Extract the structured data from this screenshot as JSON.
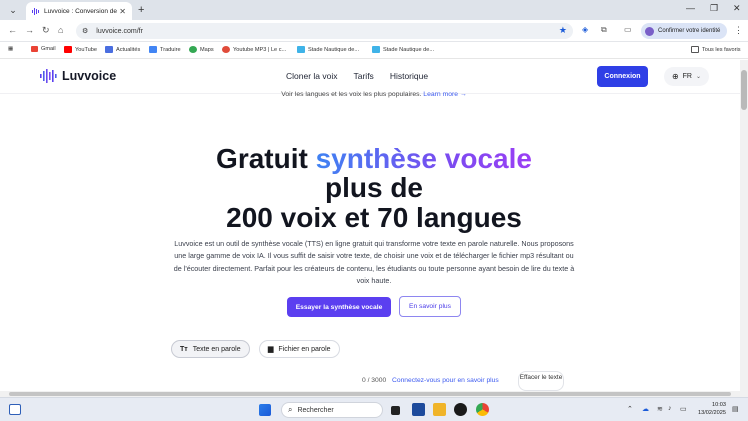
{
  "browser": {
    "tab_title": "Luvvoice : Conversion de texte",
    "url": "luvvoice.com/fr",
    "profile_label": "Confirmer votre identité",
    "bookmarks": [
      "Gmail",
      "YouTube",
      "Actualités",
      "Traduire",
      "Maps",
      "Youtube MP3 | Le c...",
      "Stade Nautique de...",
      "Stade Nautique de..."
    ],
    "all_bookmarks": "Tous les favoris"
  },
  "site": {
    "logo": "Luvvoice",
    "nav": [
      "Cloner la voix",
      "Tarifs",
      "Historique"
    ],
    "login": "Connexion",
    "language": "FR"
  },
  "hero": {
    "hint": "Voir les langues et les voix les plus populaires.",
    "hint_link": "Learn more →",
    "title_plain": "Gratuit",
    "title_gradient": "synthèse vocale",
    "title_line2": "plus de",
    "title_line3": "200 voix et 70 langues",
    "description": "Luvvoice est un outil de synthèse vocale (TTS) en ligne gratuit qui transforme votre texte en parole naturelle. Nous proposons une large gamme de voix IA. Il vous suffit de saisir votre texte, de choisir une voix et de télécharger le fichier mp3 résultant ou de l'écouter directement. Parfait pour les créateurs de contenu, les étudiants ou toute personne ayant besoin de lire du texte à voix haute.",
    "cta_primary": "Essayer la synthèse vocale",
    "cta_secondary": "En savoir plus"
  },
  "mode_tabs": [
    {
      "label": "Texte en parole",
      "icon": "text-icon",
      "active": true
    },
    {
      "label": "Fichier en parole",
      "icon": "file-icon",
      "active": false
    }
  ],
  "editor": {
    "counter": "0 / 3000",
    "login_link": "Connectez-vous pour en savoir plus",
    "clear_button": "Effacer le texte"
  },
  "taskbar": {
    "search": "Rechercher",
    "time": "10:03",
    "date": "13/02/2025"
  },
  "colors": {
    "primary": "#2f3fe6",
    "accent_purple": "#5b3ff0",
    "gradient_start": "#3f82f2",
    "gradient_end": "#9b3ef5"
  }
}
